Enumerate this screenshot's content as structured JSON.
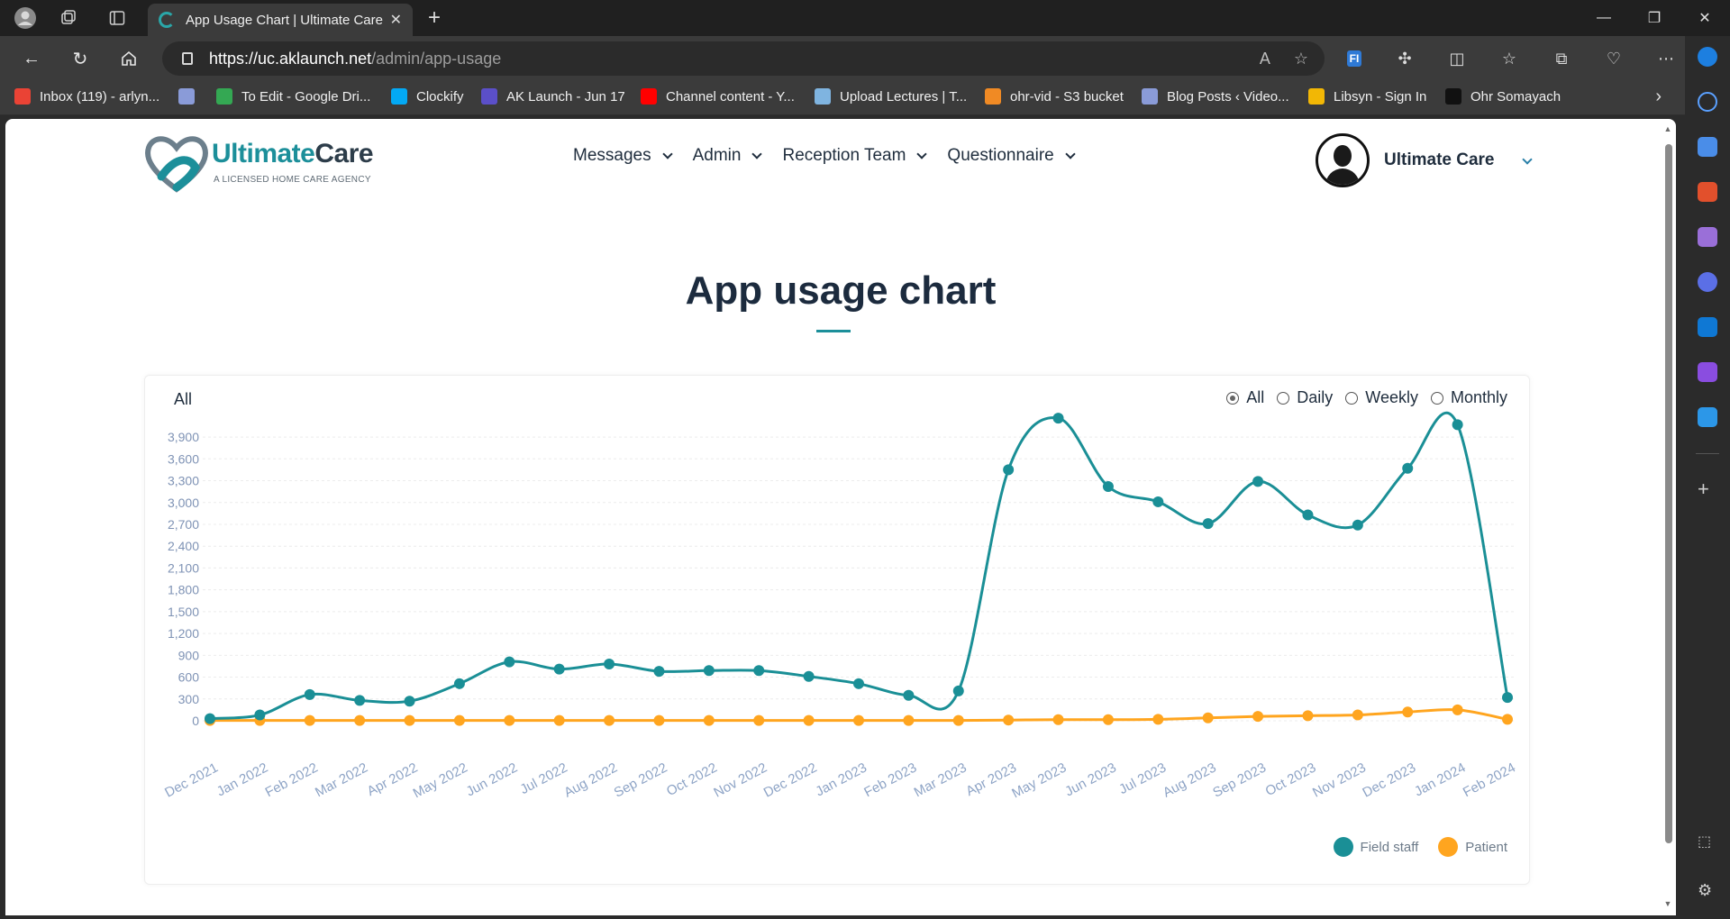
{
  "browser": {
    "tab_title": "App Usage Chart | Ultimate Care",
    "url_host": "https://uc.aklaunch.net",
    "url_path": "/admin/app-usage",
    "bookmarks": [
      {
        "label": "Inbox (119) - arlyn...",
        "color": "#ea4335"
      },
      {
        "label": "",
        "color": "#8a9bd8"
      },
      {
        "label": "To Edit - Google Dri...",
        "color": "#34a853"
      },
      {
        "label": "Clockify",
        "color": "#03a9f4"
      },
      {
        "label": "AK Launch - Jun 17",
        "color": "#5b4fc9"
      },
      {
        "label": "Channel content - Y...",
        "color": "#ff0000"
      },
      {
        "label": "Upload Lectures | T...",
        "color": "#7fb4e0"
      },
      {
        "label": "ohr-vid - S3 bucket",
        "color": "#f08a24"
      },
      {
        "label": "Blog Posts ‹ Video...",
        "color": "#8a9bd8"
      },
      {
        "label": "Libsyn - Sign In",
        "color": "#f2b705"
      },
      {
        "label": "Ohr Somayach",
        "color": "#111111"
      }
    ]
  },
  "site": {
    "logo_primary": "Ultimate",
    "logo_secondary": "Care",
    "logo_tagline": "A LICENSED HOME CARE AGENCY",
    "menu": [
      "Messages",
      "Admin",
      "Reception Team",
      "Questionnaire"
    ],
    "user_name": "Ultimate Care"
  },
  "page": {
    "title": "App usage chart",
    "filter_label": "All",
    "radio_options": [
      "All",
      "Daily",
      "Weekly",
      "Monthly"
    ],
    "radio_selected": "All"
  },
  "chart_data": {
    "type": "line",
    "title": "",
    "xlabel": "",
    "ylabel": "",
    "ylim": [
      0,
      4000
    ],
    "y_ticks": [
      0,
      300,
      600,
      900,
      1200,
      1500,
      1800,
      2100,
      2400,
      2700,
      3000,
      3300,
      3600,
      3900
    ],
    "categories": [
      "Dec 2021",
      "Jan 2022",
      "Feb 2022",
      "Mar 2022",
      "Apr 2022",
      "May 2022",
      "Jun 2022",
      "Jul 2022",
      "Aug 2022",
      "Sep 2022",
      "Oct 2022",
      "Nov 2022",
      "Dec 2022",
      "Jan 2023",
      "Feb 2023",
      "Mar 2023",
      "Apr 2023",
      "May 2023",
      "Jun 2023",
      "Jul 2023",
      "Aug 2023",
      "Sep 2023",
      "Oct 2023",
      "Nov 2023",
      "Dec 2023",
      "Jan 2024",
      "Feb 2024"
    ],
    "series": [
      {
        "name": "Field staff",
        "color": "#1a8f96",
        "values": [
          30,
          80,
          360,
          280,
          270,
          510,
          810,
          710,
          780,
          680,
          690,
          690,
          610,
          510,
          350,
          410,
          3450,
          4160,
          3220,
          3010,
          2710,
          3290,
          2830,
          2690,
          3470,
          4070,
          320
        ]
      },
      {
        "name": "Patient",
        "color": "#ffa51f",
        "values": [
          5,
          5,
          5,
          5,
          5,
          5,
          5,
          5,
          5,
          5,
          5,
          5,
          5,
          5,
          5,
          5,
          10,
          15,
          15,
          20,
          40,
          60,
          70,
          80,
          120,
          150,
          20
        ]
      }
    ],
    "grid": true,
    "legend_position": "bottom-right"
  }
}
